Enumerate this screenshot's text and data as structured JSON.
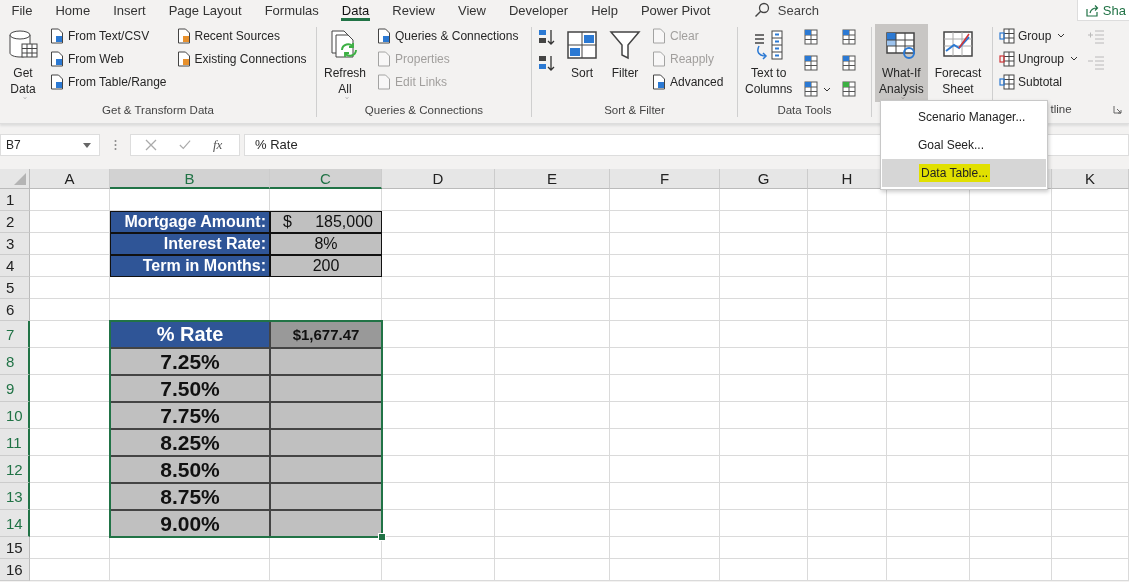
{
  "tabs": [
    {
      "label": "File",
      "selected": false
    },
    {
      "label": "Home",
      "selected": false
    },
    {
      "label": "Insert",
      "selected": false
    },
    {
      "label": "Page Layout",
      "selected": false
    },
    {
      "label": "Formulas",
      "selected": false
    },
    {
      "label": "Data",
      "selected": true
    },
    {
      "label": "Review",
      "selected": false
    },
    {
      "label": "View",
      "selected": false
    },
    {
      "label": "Developer",
      "selected": false
    },
    {
      "label": "Help",
      "selected": false
    },
    {
      "label": "Power Pivot",
      "selected": false
    }
  ],
  "search": {
    "label": "Search"
  },
  "share_button": {
    "label": "Sha"
  },
  "ribbon_groups": [
    {
      "label": "Get & Transform Data",
      "columns": [
        [
          {
            "kind": "large",
            "label": "Get\nData",
            "dropdown": true,
            "disabled": false,
            "pressed": false
          }
        ],
        [
          {
            "kind": "small",
            "label": "From Text/CSV",
            "dropdown": false,
            "disabled": false,
            "pressed": false
          },
          {
            "kind": "small",
            "label": "From Web",
            "dropdown": false,
            "disabled": false,
            "pressed": false
          },
          {
            "kind": "small",
            "label": "From Table/Range",
            "dropdown": false,
            "disabled": false,
            "pressed": false
          }
        ],
        [
          {
            "kind": "small",
            "label": "Recent Sources",
            "dropdown": false,
            "disabled": false,
            "pressed": false
          },
          {
            "kind": "small",
            "label": "Existing Connections",
            "dropdown": false,
            "disabled": false,
            "pressed": false
          }
        ]
      ]
    },
    {
      "label": "Queries & Connections",
      "columns": [
        [
          {
            "kind": "large",
            "label": "Refresh\nAll",
            "dropdown": true,
            "disabled": false,
            "pressed": false
          }
        ],
        [
          {
            "kind": "small",
            "label": "Queries & Connections",
            "dropdown": false,
            "disabled": false,
            "pressed": false
          },
          {
            "kind": "small",
            "label": "Properties",
            "dropdown": false,
            "disabled": true,
            "pressed": false
          },
          {
            "kind": "small",
            "label": "Edit Links",
            "dropdown": false,
            "disabled": true,
            "pressed": false
          }
        ]
      ]
    },
    {
      "label": "Sort & Filter",
      "columns": [
        [
          {
            "kind": "icon",
            "dropdown": false,
            "disabled": false,
            "pressed": false
          },
          {
            "kind": "icon",
            "dropdown": false,
            "disabled": false,
            "pressed": false
          }
        ],
        [
          {
            "kind": "large",
            "label": "Sort",
            "dropdown": false,
            "disabled": false,
            "pressed": false
          }
        ],
        [
          {
            "kind": "large",
            "label": "Filter",
            "dropdown": false,
            "disabled": false,
            "pressed": false
          }
        ],
        [
          {
            "kind": "small",
            "label": "Clear",
            "dropdown": false,
            "disabled": true,
            "pressed": false
          },
          {
            "kind": "small",
            "label": "Reapply",
            "dropdown": false,
            "disabled": true,
            "pressed": false
          },
          {
            "kind": "small",
            "label": "Advanced",
            "dropdown": false,
            "disabled": false,
            "pressed": false
          }
        ]
      ]
    },
    {
      "label": "Data Tools",
      "columns": [
        [
          {
            "kind": "large",
            "label": "Text to\nColumns",
            "dropdown": false,
            "disabled": false,
            "pressed": false
          }
        ],
        [
          {
            "kind": "icon",
            "dropdown": false,
            "disabled": false,
            "pressed": false
          },
          {
            "kind": "icon",
            "dropdown": false,
            "disabled": false,
            "pressed": false
          },
          {
            "kind": "icon",
            "dropdown": true,
            "disabled": false,
            "pressed": false
          }
        ],
        [
          {
            "kind": "icon",
            "dropdown": false,
            "disabled": false,
            "pressed": false
          },
          {
            "kind": "icon",
            "dropdown": false,
            "disabled": false,
            "pressed": false
          },
          {
            "kind": "icon",
            "dropdown": false,
            "disabled": false,
            "pressed": false
          }
        ]
      ]
    },
    {
      "columns": [
        [
          {
            "kind": "large",
            "label": "What-If\nAnalysis",
            "dropdown": true,
            "disabled": false,
            "pressed": true
          }
        ],
        [
          {
            "kind": "large",
            "label": "Forecast\nSheet",
            "dropdown": false,
            "disabled": false,
            "pressed": false
          }
        ]
      ]
    },
    {
      "label": "tline",
      "launcher": true,
      "columns": [
        [
          {
            "kind": "small",
            "label": "Group",
            "dropdown": true,
            "disabled": false,
            "pressed": false
          },
          {
            "kind": "small",
            "label": "Ungroup",
            "dropdown": true,
            "disabled": false,
            "pressed": false
          },
          {
            "kind": "small",
            "label": "Subtotal",
            "dropdown": false,
            "disabled": false,
            "pressed": false
          }
        ],
        [
          {
            "kind": "icon",
            "dropdown": false,
            "disabled": true,
            "pressed": false
          },
          {
            "kind": "icon",
            "dropdown": false,
            "disabled": true,
            "pressed": false
          }
        ]
      ]
    }
  ],
  "dropdown_menu": {
    "items": [
      {
        "label": "Scenario Manager...",
        "selected": false,
        "highlighted": false
      },
      {
        "label": "Goal Seek...",
        "selected": false,
        "highlighted": false
      },
      {
        "label": "Data Table...",
        "selected": true,
        "highlighted": true
      }
    ]
  },
  "formula_bar": {
    "name_box": "B7",
    "function_label": "fx",
    "value": "% Rate"
  },
  "sheet": {
    "columns": [
      {
        "label": "A",
        "selected": false
      },
      {
        "label": "B",
        "selected": true
      },
      {
        "label": "C",
        "selected": true
      },
      {
        "label": "D",
        "selected": false
      },
      {
        "label": "E",
        "selected": false
      },
      {
        "label": "F",
        "selected": false
      },
      {
        "label": "G",
        "selected": false
      },
      {
        "label": "H",
        "selected": false
      },
      {
        "label": "K",
        "selected": false
      }
    ],
    "rows": [
      {
        "number": "1",
        "selected": false
      },
      {
        "number": "2",
        "selected": false,
        "kind": "input",
        "label": "Mortgage Amount:",
        "currency": "$",
        "value": "185,000"
      },
      {
        "number": "3",
        "selected": false,
        "kind": "input",
        "label": "Interest Rate:",
        "value": "8%"
      },
      {
        "number": "4",
        "selected": false,
        "kind": "input",
        "label": "Term in Months:",
        "value": "200"
      },
      {
        "number": "5",
        "selected": false
      },
      {
        "number": "6",
        "selected": false
      },
      {
        "number": "7",
        "selected": true,
        "kind": "table_head",
        "label": "% Rate",
        "value": "$1,677.47"
      },
      {
        "number": "8",
        "selected": true,
        "kind": "table_row",
        "label": "7.25%"
      },
      {
        "number": "9",
        "selected": true,
        "kind": "table_row",
        "label": "7.50%"
      },
      {
        "number": "10",
        "selected": true,
        "kind": "table_row",
        "label": "7.75%"
      },
      {
        "number": "11",
        "selected": true,
        "kind": "table_row",
        "label": "8.25%"
      },
      {
        "number": "12",
        "selected": true,
        "kind": "table_row",
        "label": "8.50%"
      },
      {
        "number": "13",
        "selected": true,
        "kind": "table_row",
        "label": "8.75%"
      },
      {
        "number": "14",
        "selected": true,
        "kind": "table_row",
        "label": "9.00%"
      },
      {
        "number": "15",
        "selected": false
      },
      {
        "number": "16",
        "selected": false
      }
    ]
  }
}
